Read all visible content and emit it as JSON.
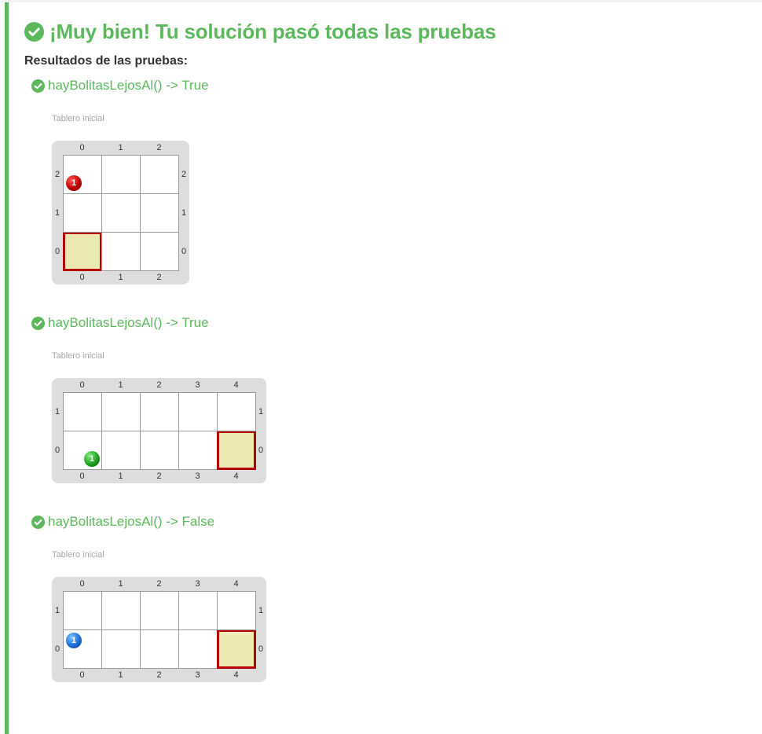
{
  "title": "¡Muy bien! Tu solución pasó todas las pruebas",
  "results_heading": "Resultados de las pruebas:",
  "colors": {
    "success": "#5cb85c",
    "board_frame": "#dddddd",
    "head_fill": "#ece9b5",
    "head_border": "#b30000",
    "ball_red": "#c10000",
    "ball_green": "#22a122",
    "ball_blue": "#1a6fd6"
  },
  "tests": [
    {
      "label": "hayBolitasLejosAl() -> True",
      "board_caption": "Tablero inicial",
      "board": {
        "columns": 3,
        "rows": 3,
        "col_labels": [
          "0",
          "1",
          "2"
        ],
        "row_labels": [
          "2",
          "1",
          "0"
        ],
        "head": {
          "col": 0,
          "row": 0
        },
        "balls": [
          {
            "col": 0,
            "row": 2,
            "color": "red",
            "count": "1"
          }
        ]
      }
    },
    {
      "label": "hayBolitasLejosAl() -> True",
      "board_caption": "Tablero inicial",
      "board": {
        "columns": 5,
        "rows": 2,
        "col_labels": [
          "0",
          "1",
          "2",
          "3",
          "4"
        ],
        "row_labels": [
          "1",
          "0"
        ],
        "head": {
          "col": 4,
          "row": 0
        },
        "balls": [
          {
            "col": 0,
            "row": 0,
            "color": "green",
            "count": "1"
          }
        ]
      }
    },
    {
      "label": "hayBolitasLejosAl() -> False",
      "board_caption": "Tablero inicial",
      "board": {
        "columns": 5,
        "rows": 2,
        "col_labels": [
          "0",
          "1",
          "2",
          "3",
          "4"
        ],
        "row_labels": [
          "1",
          "0"
        ],
        "head": {
          "col": 4,
          "row": 0
        },
        "balls": [
          {
            "col": 0,
            "row": 0,
            "color": "blue",
            "count": "1"
          }
        ]
      }
    }
  ]
}
